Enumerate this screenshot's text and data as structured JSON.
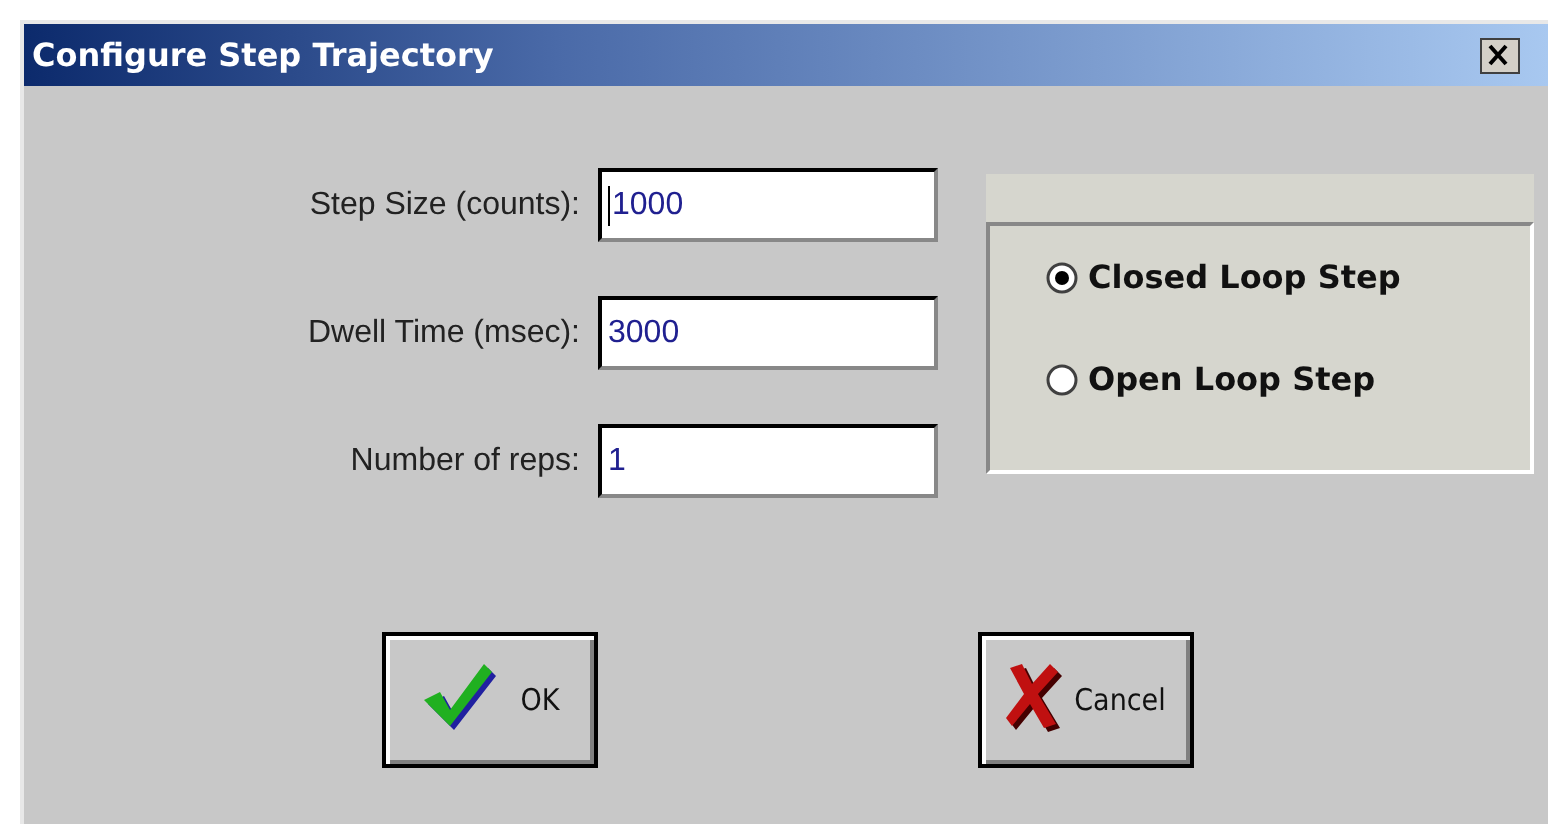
{
  "window": {
    "title": "Configure Step Trajectory"
  },
  "fields": [
    {
      "label": "Step Size (counts):",
      "value": "1000",
      "focused": true
    },
    {
      "label": "Dwell Time (msec):",
      "value": "3000",
      "focused": false
    },
    {
      "label": "Number of reps:",
      "value": "1",
      "focused": false
    }
  ],
  "step_mode": [
    {
      "label": "Closed Loop Step",
      "selected": true
    },
    {
      "label": "Open Loop Step",
      "selected": false
    }
  ],
  "buttons": [
    {
      "kind": "ok",
      "label": "OK"
    },
    {
      "kind": "cancel",
      "label": "Cancel"
    }
  ]
}
